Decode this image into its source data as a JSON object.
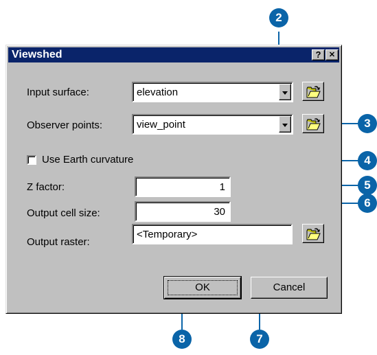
{
  "dialog": {
    "title": "Viewshed",
    "help_button": "?",
    "close_button": "✕",
    "fields": {
      "input_surface": {
        "label": "Input surface:",
        "value": "elevation"
      },
      "observer_points": {
        "label": "Observer points:",
        "value": "view_point"
      },
      "use_earth_curvature": {
        "label": "Use Earth curvature",
        "checked": false
      },
      "z_factor": {
        "label": "Z factor:",
        "value": "1"
      },
      "output_cell_size": {
        "label": "Output cell size:",
        "value": "30"
      },
      "output_raster": {
        "label": "Output raster:",
        "value": "<Temporary>"
      }
    },
    "buttons": {
      "ok": "OK",
      "cancel": "Cancel"
    }
  },
  "callouts": [
    "2",
    "3",
    "4",
    "5",
    "6",
    "7",
    "8"
  ],
  "icons": {
    "browse": "open-folder-icon",
    "dropdown": "chevron-down-icon"
  },
  "colors": {
    "callout": "#0a64a8",
    "titlebar": "#0a246a",
    "dialog_face": "#c0c0c0"
  }
}
